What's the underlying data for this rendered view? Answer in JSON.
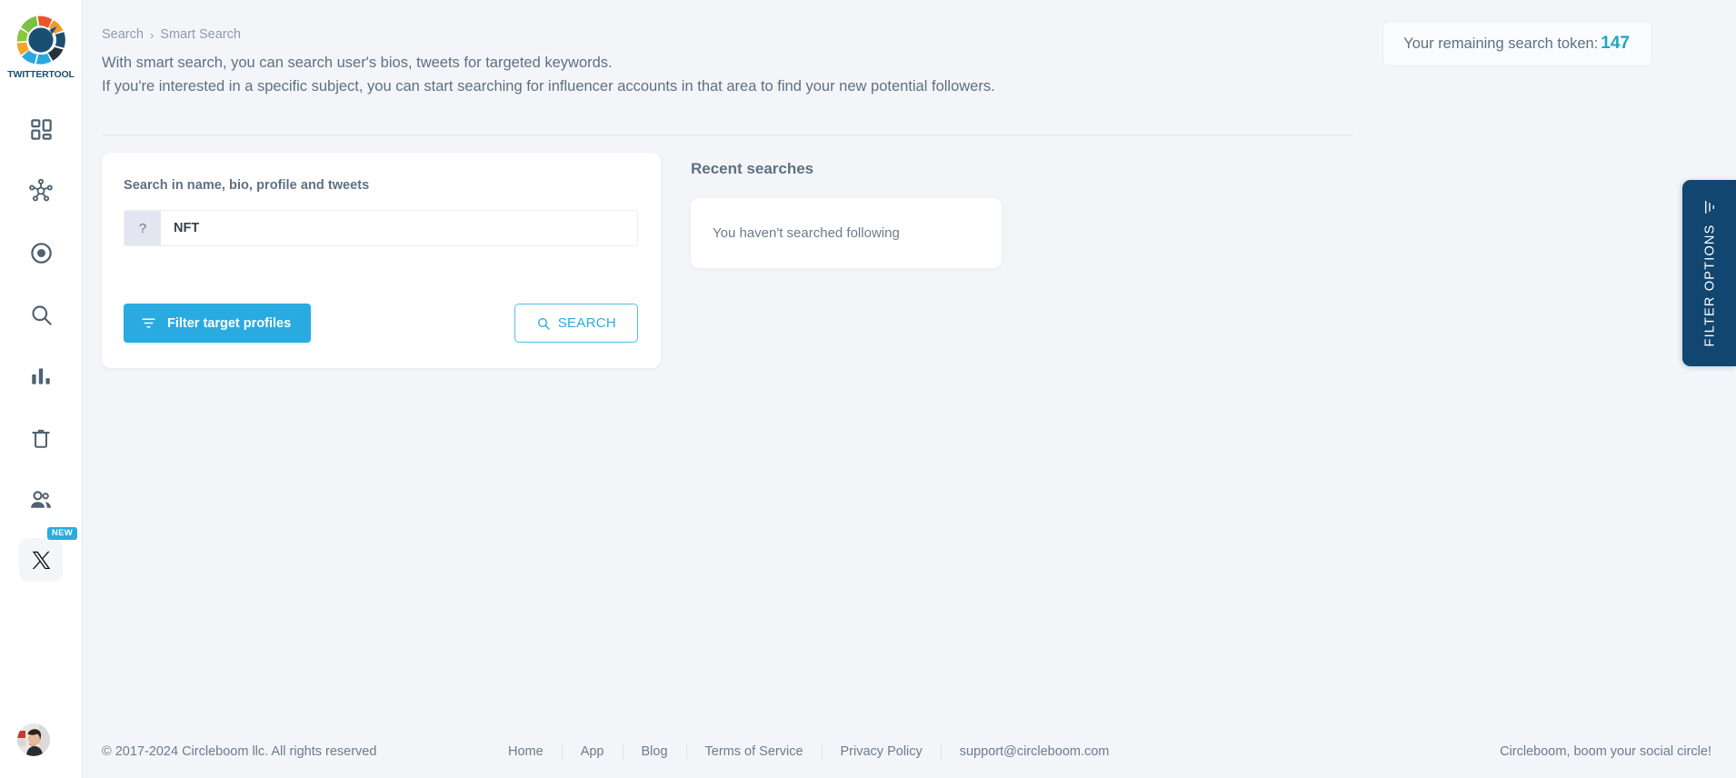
{
  "brand": {
    "logo_name": "circleboom-logo",
    "logo_text": "TWITTERTOOL"
  },
  "sidebar": {
    "items": [
      {
        "name": "dashboard",
        "icon": "grid-dashboard-icon"
      },
      {
        "name": "network",
        "icon": "network-hub-icon"
      },
      {
        "name": "target",
        "icon": "target-circle-icon"
      },
      {
        "name": "search",
        "icon": "search-icon"
      },
      {
        "name": "analytics",
        "icon": "bar-chart-icon"
      },
      {
        "name": "delete",
        "icon": "trash-icon"
      },
      {
        "name": "users",
        "icon": "users-icon"
      }
    ],
    "x_item": {
      "icon": "x-logo-icon",
      "badge": "NEW"
    },
    "avatar": "user-avatar"
  },
  "breadcrumb": {
    "parent": "Search",
    "separator": "›",
    "current": "Smart Search"
  },
  "intro": {
    "line1": "With smart search, you can search user's bios, tweets for targeted keywords.",
    "line2": "If you're interested in a specific subject, you can start searching for influencer accounts in that area to find your new potential followers."
  },
  "token": {
    "label": "Your remaining search token:",
    "count": "147",
    "accent_color": "#1aa7c0"
  },
  "search_card": {
    "label": "Search in name, bio, profile and tweets",
    "help_icon": "question-mark-icon",
    "input_value": "NFT",
    "input_placeholder": "",
    "filter_button": "Filter target profiles",
    "filter_icon": "filter-icon",
    "search_button": "SEARCH",
    "search_icon": "search-icon"
  },
  "recent": {
    "title": "Recent searches",
    "empty_text": "You haven't searched following"
  },
  "filter_tab": {
    "label": "FILTER OPTIONS",
    "icon": "filter-icon",
    "color": "#10466f"
  },
  "footer": {
    "copyright": "© 2017-2024 Circleboom llc. All rights reserved",
    "links": [
      "Home",
      "App",
      "Blog",
      "Terms of Service",
      "Privacy Policy",
      "support@circleboom.com"
    ],
    "tagline": "Circleboom, boom your social circle!"
  },
  "colors": {
    "accent_blue": "#29abe2",
    "dark_navy": "#10466f",
    "page_bg": "#f4f5f9",
    "text_muted": "#6b7c8d"
  }
}
